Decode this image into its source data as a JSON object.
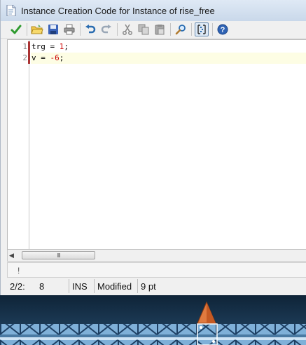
{
  "window": {
    "title": "Instance Creation Code for Instance of rise_free"
  },
  "toolbar": {
    "buttons": [
      {
        "name": "ok-icon",
        "tooltip": "OK"
      },
      {
        "name": "open-icon",
        "tooltip": "Open"
      },
      {
        "name": "save-icon",
        "tooltip": "Save"
      },
      {
        "name": "print-icon",
        "tooltip": "Print"
      },
      {
        "name": "undo-icon",
        "tooltip": "Undo"
      },
      {
        "name": "redo-icon",
        "tooltip": "Redo"
      },
      {
        "name": "cut-icon",
        "tooltip": "Cut"
      },
      {
        "name": "copy-icon",
        "tooltip": "Copy"
      },
      {
        "name": "paste-icon",
        "tooltip": "Paste"
      },
      {
        "name": "find-icon",
        "tooltip": "Find"
      },
      {
        "name": "syntax-check-icon",
        "tooltip": "Check syntax"
      },
      {
        "name": "help-icon",
        "tooltip": "Help"
      }
    ]
  },
  "editor": {
    "lines": [
      {
        "number": "1",
        "pre": "trg = ",
        "num": "1",
        "post": ";"
      },
      {
        "number": "2",
        "pre": "v = ",
        "num": "-6",
        "post": ";"
      }
    ]
  },
  "scroll": {
    "thumb_grip": "III"
  },
  "message": {
    "text": "!"
  },
  "status": {
    "position": "2/2:",
    "column": "8",
    "mode": "INS",
    "state": "Modified",
    "font_size": "9 pt"
  },
  "colors": {
    "accent": "#2a6cb0",
    "number": "#cc0000",
    "current_line": "#fdfde4",
    "game_bg": "#16324a"
  }
}
